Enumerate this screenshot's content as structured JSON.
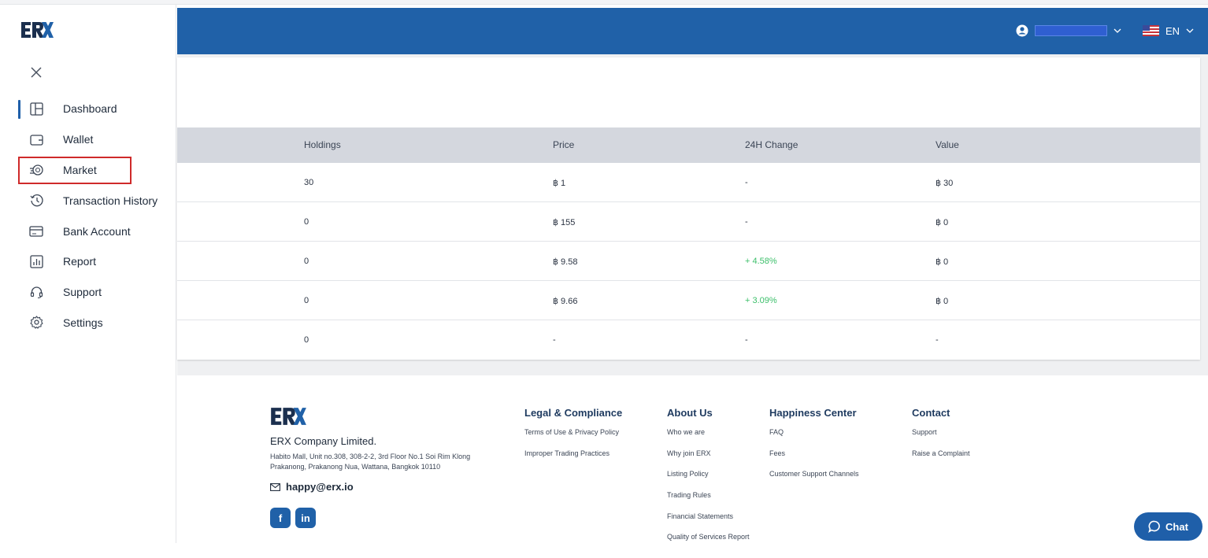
{
  "brand": {
    "logo_text": "ERX"
  },
  "sidebar": {
    "items": [
      {
        "label": "Dashboard",
        "icon": "dashboard-icon"
      },
      {
        "label": "Wallet",
        "icon": "wallet-icon"
      },
      {
        "label": "Market",
        "icon": "market-icon"
      },
      {
        "label": "Transaction History",
        "icon": "history-icon"
      },
      {
        "label": "Bank Account",
        "icon": "bank-card-icon"
      },
      {
        "label": "Report",
        "icon": "report-chart-icon"
      },
      {
        "label": "Support",
        "icon": "headset-icon"
      },
      {
        "label": "Settings",
        "icon": "gear-icon"
      }
    ]
  },
  "header": {
    "language": "EN",
    "user_icon": "user-circle-icon",
    "flag_icon": "us-flag-icon",
    "accent": "#2061a8"
  },
  "table": {
    "columns": [
      "Holdings",
      "Price",
      "24H Change",
      "Value"
    ],
    "rows": [
      {
        "holdings": "30",
        "price": "฿ 1",
        "change": "-",
        "value": "฿ 30"
      },
      {
        "holdings": "0",
        "price": "฿ 155",
        "change": "-",
        "value": "฿ 0"
      },
      {
        "holdings": "0",
        "price": "฿ 9.58",
        "change": "+ 4.58%",
        "value": "฿ 0"
      },
      {
        "holdings": "0",
        "price": "฿ 9.66",
        "change": "+ 3.09%",
        "value": "฿ 0"
      },
      {
        "holdings": "0",
        "price": "-",
        "change": "-",
        "value": "-"
      }
    ],
    "positive_color": "#3cbf6a"
  },
  "footer": {
    "company": "ERX Company Limited.",
    "address": "Habito Mall, Unit no.308, 308-2-2, 3rd Floor No.1 Soi Rim Klong Prakanong, Prakanong Nua, Wattana, Bangkok 10110",
    "email": "happy@erx.io",
    "social": [
      "f",
      "in"
    ],
    "columns": [
      {
        "title": "Legal & Compliance",
        "links": [
          "Terms of Use & Privacy Policy",
          "Improper Trading Practices"
        ]
      },
      {
        "title": "About Us",
        "links": [
          "Who we are",
          "Why join ERX",
          "Listing Policy",
          "Trading Rules",
          "Financial Statements",
          "Quality of Services Report"
        ]
      },
      {
        "title": "Happiness Center",
        "links": [
          "FAQ",
          "Fees",
          "Customer Support Channels"
        ]
      },
      {
        "title": "Contact",
        "links": [
          "Support",
          "Raise a Complaint"
        ]
      }
    ]
  },
  "chat": {
    "label": "Chat"
  }
}
